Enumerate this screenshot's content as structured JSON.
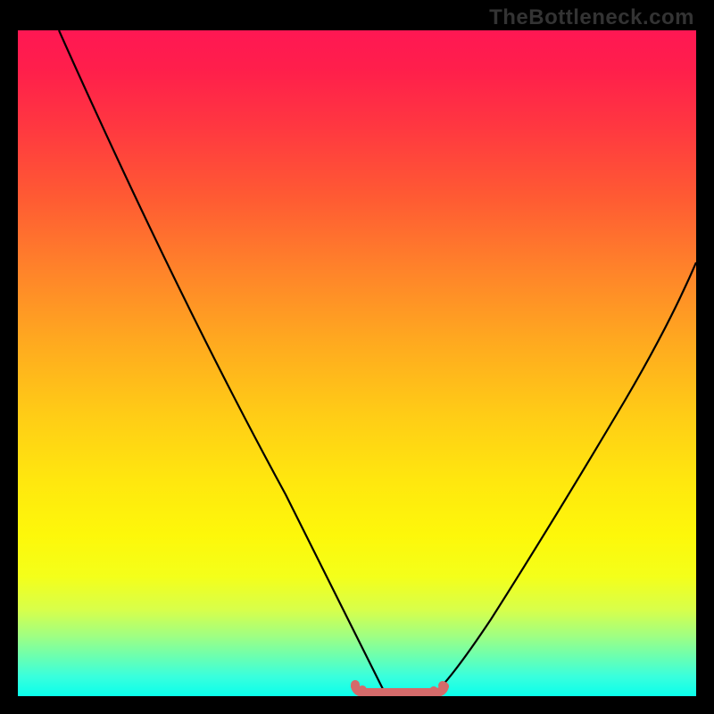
{
  "watermark": "TheBottleneck.com",
  "chart_data": {
    "type": "line",
    "title": "",
    "xlabel": "",
    "ylabel": "",
    "xlim": [
      0,
      100
    ],
    "ylim": [
      0,
      100
    ],
    "left_curve": {
      "x": [
        6,
        10,
        15,
        20,
        25,
        30,
        35,
        40,
        45,
        48,
        50,
        52,
        54
      ],
      "y": [
        100,
        92,
        82,
        72,
        62,
        52,
        42,
        32,
        20,
        12,
        6,
        2,
        0
      ]
    },
    "right_curve": {
      "x": [
        62,
        64,
        68,
        72,
        76,
        80,
        84,
        88,
        92,
        96,
        100
      ],
      "y": [
        0,
        2,
        8,
        15,
        24,
        33,
        42,
        50,
        57,
        63,
        67
      ]
    },
    "baseline_segment": {
      "x": [
        49,
        63
      ],
      "y": [
        0.8,
        0.8
      ],
      "color": "#d46a6a",
      "style": "dotted-thick"
    },
    "background_gradient": {
      "stops": [
        {
          "pos": 0,
          "color": "#ff1753"
        },
        {
          "pos": 25,
          "color": "#ff5a33"
        },
        {
          "pos": 50,
          "color": "#ffb81c"
        },
        {
          "pos": 75,
          "color": "#fbf80c"
        },
        {
          "pos": 100,
          "color": "#0affec"
        }
      ]
    }
  }
}
